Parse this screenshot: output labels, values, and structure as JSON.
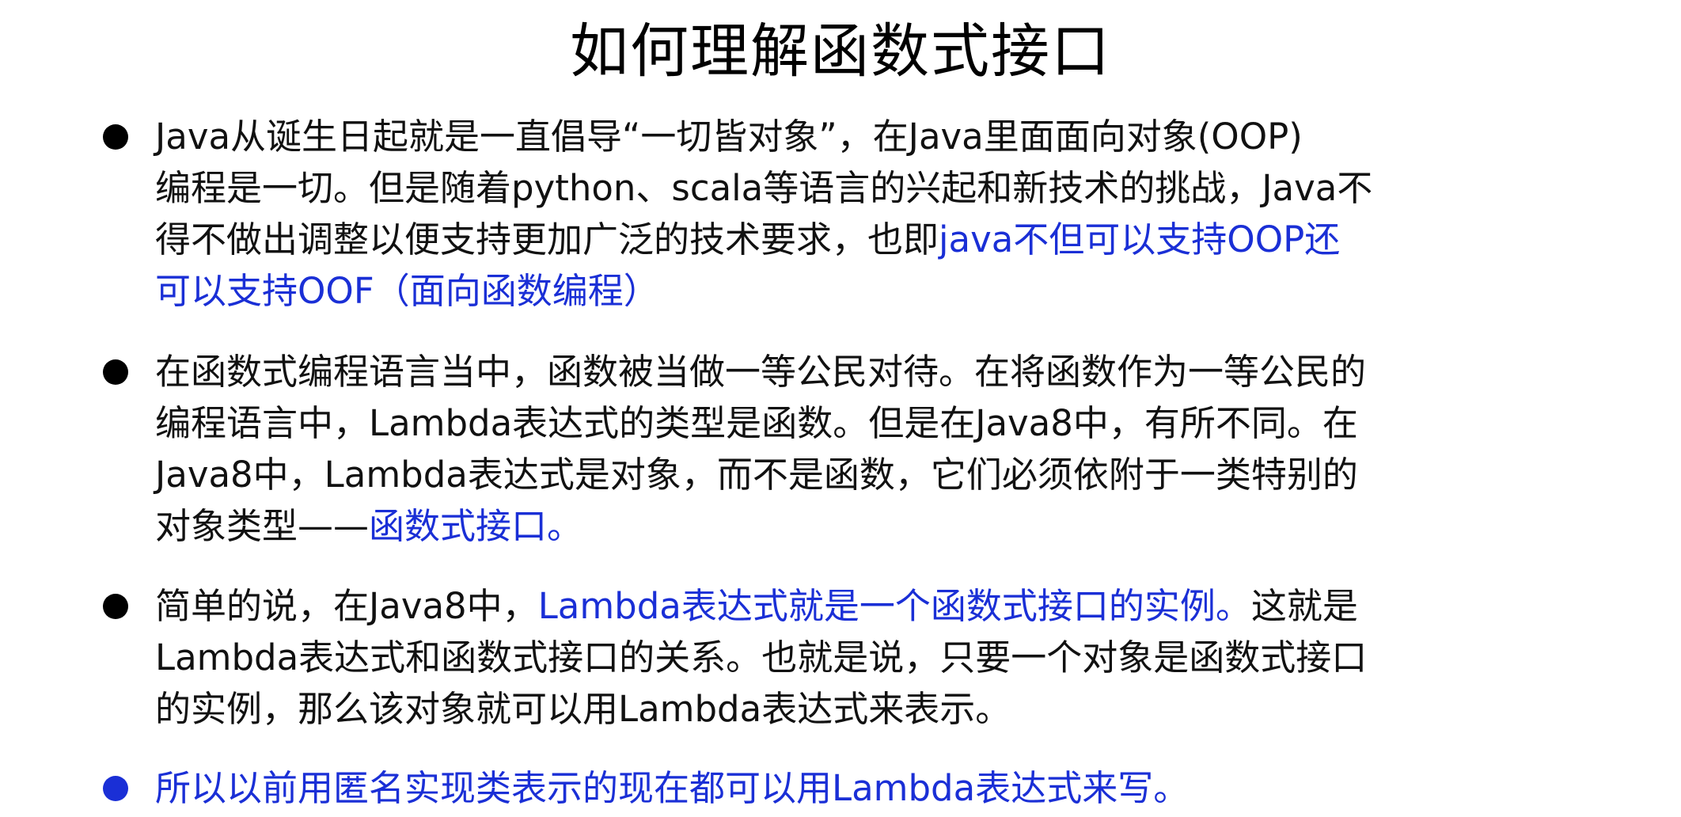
{
  "title": "如何理解函数式接口",
  "colors": {
    "text": "#111111",
    "highlight": "#1a2fd6",
    "bullet_default": "#000000",
    "bullet_highlight": "#1a2fd6"
  },
  "bullets": [
    {
      "lines": [
        [
          "Java从诞生日起就是一直倡导“一切皆对象”，在Java里面面向对象(OOP)"
        ],
        [
          "编程是一切。但是随着python、scala等语言的兴起和新技术的挑战，Java不"
        ],
        [
          "得不做出调整以便支持更加广泛的技术要求，也即",
          "java不但可以支持OOP还"
        ],
        [
          "可以支持OOF（面向函数编程）"
        ]
      ]
    },
    {
      "lines": [
        [
          "在函数式编程语言当中，函数被当做一等公民对待。在将函数作为一等公民的"
        ],
        [
          "编程语言中，Lambda表达式的类型是函数。但是在Java8中，有所不同。在"
        ],
        [
          "Java8中，Lambda表达式是对象，而不是函数，它们必须依附于一类特别的"
        ],
        [
          "对象类型——",
          "函数式接口。"
        ]
      ]
    },
    {
      "lines": [
        [
          "简单的说，在Java8中，",
          "Lambda表达式就是一个函数式接口的实例。",
          "这就是"
        ],
        [
          "Lambda表达式和函数式接口的关系。也就是说，只要一个对象是函数式接口"
        ],
        [
          "的实例，那么该对象就可以用Lambda表达式来表示。"
        ]
      ]
    },
    {
      "lines": [
        [
          "所以以前用匿名实现类表示的现在都可以用Lambda表达式来写。"
        ]
      ]
    }
  ]
}
